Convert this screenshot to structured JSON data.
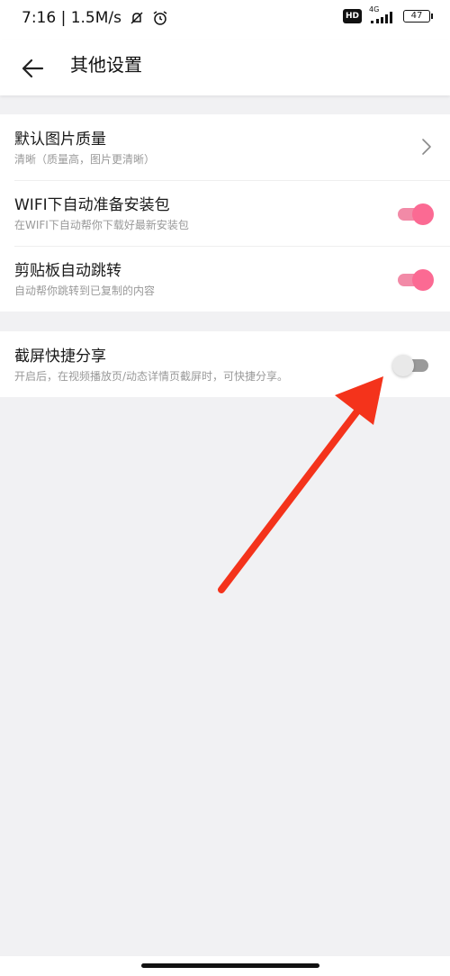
{
  "status_bar": {
    "time_speed": "7:16 | 1.5M/s",
    "hd_label": "HD",
    "network": "4G",
    "battery": "47"
  },
  "header": {
    "title": "其他设置"
  },
  "settings_group_1": [
    {
      "title": "默认图片质量",
      "subtitle": "清晰（质量高，图片更清晰）",
      "control": "chevron-right-icon"
    },
    {
      "title": "WIFI下自动准备安装包",
      "subtitle": "在WIFI下自动帮你下载好最新安装包",
      "toggle_on": true
    },
    {
      "title": "剪贴板自动跳转",
      "subtitle": "自动帮你跳转到已复制的内容",
      "toggle_on": true
    }
  ],
  "settings_group_2": [
    {
      "title": "截屏快捷分享",
      "subtitle": "开启后，在视频播放页/动态详情页截屏时，可快捷分享。",
      "toggle_on": false
    }
  ],
  "colors": {
    "toggle_on": "#fb6a93",
    "toggle_track_on": "#f28aa7",
    "annotation_arrow": "#f4331b",
    "background": "#f1f1f3"
  }
}
